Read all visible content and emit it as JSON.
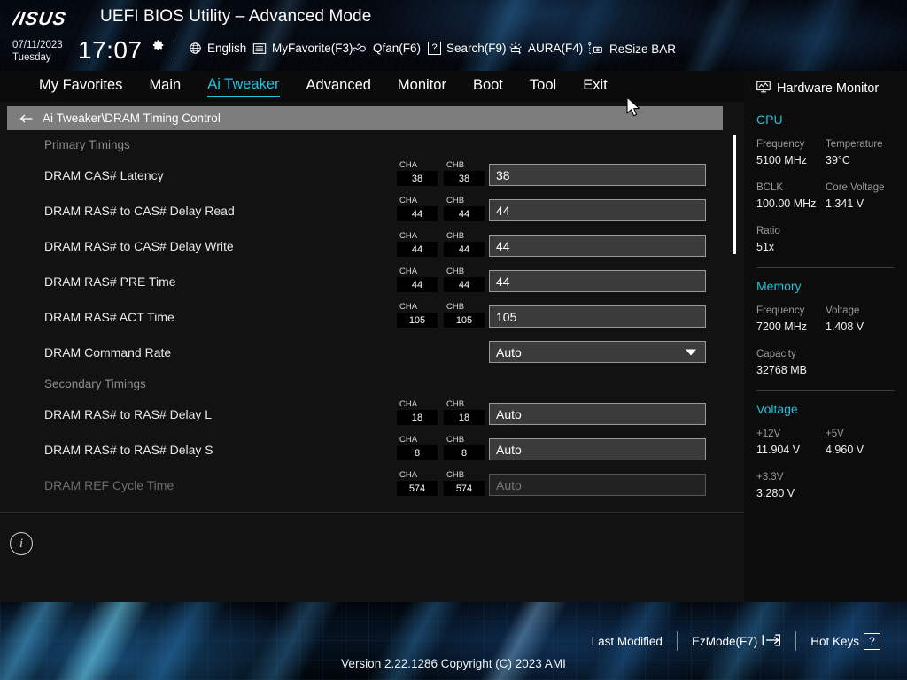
{
  "header": {
    "logo": "/ISUS",
    "title": "UEFI BIOS Utility – Advanced Mode",
    "date": "07/11/2023",
    "weekday": "Tuesday",
    "time": "17:07",
    "gear_icon": "gear-icon",
    "items": [
      {
        "icon": "globe-icon",
        "label": "English"
      },
      {
        "icon": "myfavorite-icon",
        "label": "MyFavorite(F3)"
      },
      {
        "icon": "qfan-icon",
        "label": "Qfan(F6)"
      },
      {
        "icon": "search-icon",
        "label": "Search(F9)"
      },
      {
        "icon": "aura-icon",
        "label": "AURA(F4)"
      },
      {
        "icon": "resizebar-icon",
        "label": "ReSize BAR"
      }
    ]
  },
  "nav": {
    "tabs": [
      {
        "label": "My Favorites",
        "active": false
      },
      {
        "label": "Main",
        "active": false
      },
      {
        "label": "Ai Tweaker",
        "active": true
      },
      {
        "label": "Advanced",
        "active": false
      },
      {
        "label": "Monitor",
        "active": false
      },
      {
        "label": "Boot",
        "active": false
      },
      {
        "label": "Tool",
        "active": false
      },
      {
        "label": "Exit",
        "active": false
      }
    ],
    "accent_color": "#1fc4dd"
  },
  "breadcrumb": {
    "back_icon": "back-arrow-icon",
    "path": "Ai Tweaker\\DRAM Timing Control"
  },
  "settings": {
    "sections": [
      {
        "heading": "Primary Timings",
        "rows": [
          {
            "label": "DRAM CAS# Latency",
            "cha_label": "CHA",
            "cha": "38",
            "chb_label": "CHB",
            "chb": "38",
            "value": "38",
            "type": "text",
            "dim": false
          },
          {
            "label": "DRAM RAS# to CAS# Delay Read",
            "cha_label": "CHA",
            "cha": "44",
            "chb_label": "CHB",
            "chb": "44",
            "value": "44",
            "type": "text",
            "dim": false
          },
          {
            "label": "DRAM RAS# to CAS# Delay Write",
            "cha_label": "CHA",
            "cha": "44",
            "chb_label": "CHB",
            "chb": "44",
            "value": "44",
            "type": "text",
            "dim": false
          },
          {
            "label": "DRAM RAS# PRE Time",
            "cha_label": "CHA",
            "cha": "44",
            "chb_label": "CHB",
            "chb": "44",
            "value": "44",
            "type": "text",
            "dim": false
          },
          {
            "label": "DRAM RAS# ACT Time",
            "cha_label": "CHA",
            "cha": "105",
            "chb_label": "CHB",
            "chb": "105",
            "value": "105",
            "type": "text",
            "dim": false
          },
          {
            "label": "DRAM Command Rate",
            "cha_label": "",
            "cha": "",
            "chb_label": "",
            "chb": "",
            "value": "Auto",
            "type": "select",
            "dim": false
          }
        ]
      },
      {
        "heading": "Secondary Timings",
        "rows": [
          {
            "label": "DRAM RAS# to RAS# Delay L",
            "cha_label": "CHA",
            "cha": "18",
            "chb_label": "CHB",
            "chb": "18",
            "value": "Auto",
            "type": "text",
            "dim": false
          },
          {
            "label": "DRAM RAS# to RAS# Delay S",
            "cha_label": "CHA",
            "cha": "8",
            "chb_label": "CHB",
            "chb": "8",
            "value": "Auto",
            "type": "text",
            "dim": false
          },
          {
            "label": "DRAM REF Cycle Time",
            "cha_label": "CHA",
            "cha": "574",
            "chb_label": "CHB",
            "chb": "574",
            "value": "Auto",
            "type": "text",
            "dim": true
          }
        ]
      }
    ]
  },
  "info_panel": {
    "icon": "info-icon",
    "text": ""
  },
  "hardware_monitor": {
    "title": "Hardware Monitor",
    "title_icon": "monitor-icon",
    "section_color": "#21c0d8",
    "sections": [
      {
        "name": "CPU",
        "pairs": [
          [
            {
              "key": "Frequency",
              "value": "5100 MHz"
            },
            {
              "key": "Temperature",
              "value": "39°C"
            }
          ],
          [
            {
              "key": "BCLK",
              "value": "100.00 MHz"
            },
            {
              "key": "Core Voltage",
              "value": "1.341 V"
            }
          ],
          [
            {
              "key": "Ratio",
              "value": "51x"
            }
          ]
        ]
      },
      {
        "name": "Memory",
        "pairs": [
          [
            {
              "key": "Frequency",
              "value": "7200 MHz"
            },
            {
              "key": "Voltage",
              "value": "1.408 V"
            }
          ],
          [
            {
              "key": "Capacity",
              "value": "32768 MB"
            }
          ]
        ]
      },
      {
        "name": "Voltage",
        "pairs": [
          [
            {
              "key": "+12V",
              "value": "11.904 V"
            },
            {
              "key": "+5V",
              "value": "4.960 V"
            }
          ],
          [
            {
              "key": "+3.3V",
              "value": "3.280 V"
            }
          ]
        ]
      }
    ]
  },
  "footer": {
    "last_modified": "Last Modified",
    "ezmode": "EzMode(F7)",
    "ezmode_icon": "exit-arrow-icon",
    "hotkeys": "Hot Keys",
    "hotkeys_key": "?",
    "version": "Version 2.22.1286 Copyright (C) 2023 AMI"
  }
}
